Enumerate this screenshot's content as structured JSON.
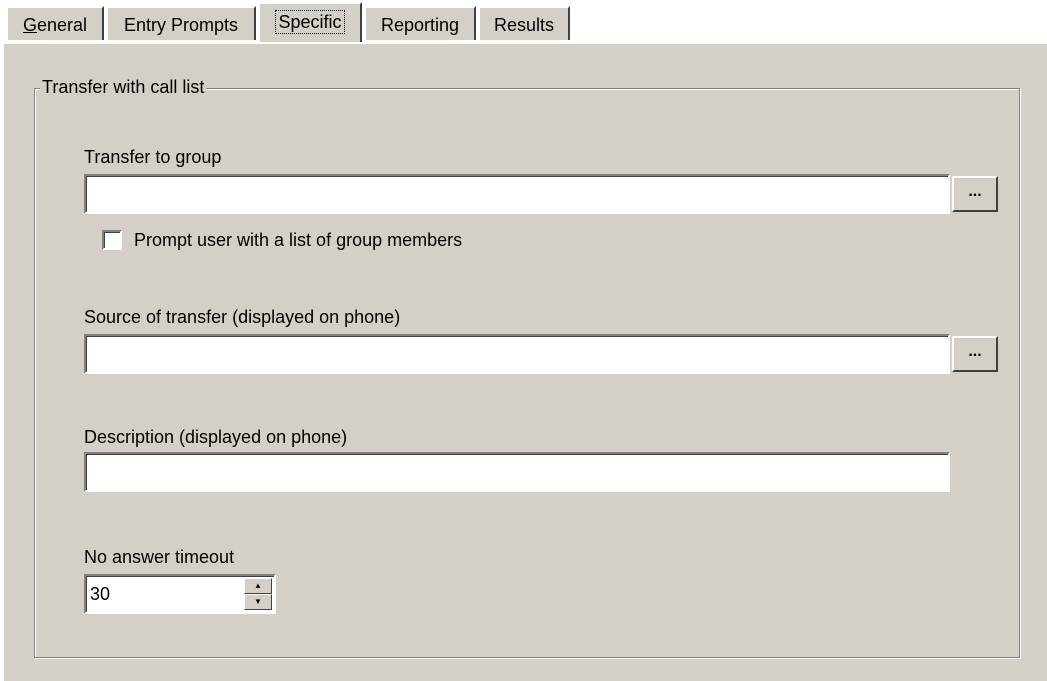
{
  "tabs": [
    {
      "accel": "G",
      "rest": "eneral",
      "active": false
    },
    {
      "accel": "",
      "rest": "Entry Prompts",
      "active": false
    },
    {
      "accel": "",
      "rest": "Specific",
      "active": true
    },
    {
      "accel": "",
      "rest": "Reporting",
      "active": false
    },
    {
      "accel": "",
      "rest": "Results",
      "active": false
    }
  ],
  "group": {
    "title": "Transfer with call list"
  },
  "transfer_to_group": {
    "label": "Transfer to group",
    "value": "",
    "browse_label": "..."
  },
  "prompt_checkbox": {
    "label": "Prompt user with a list of group members",
    "checked": false
  },
  "source_of_transfer": {
    "label": "Source of transfer (displayed on phone)",
    "value": "",
    "browse_label": "..."
  },
  "description": {
    "label": "Description (displayed on phone)",
    "value": ""
  },
  "no_answer_timeout": {
    "label": "No answer timeout",
    "value": "30",
    "up_glyph": "▲",
    "down_glyph": "▼"
  },
  "colors": {
    "panel": "#d4d0c8",
    "field": "#ffffff",
    "shadow": "#808080",
    "highlight": "#ffffff"
  }
}
